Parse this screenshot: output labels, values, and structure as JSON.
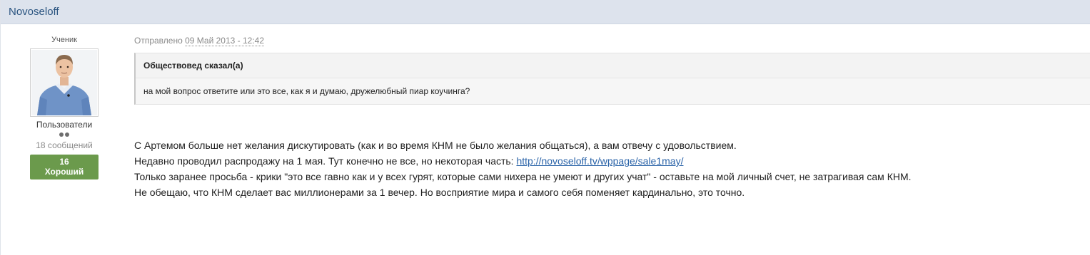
{
  "author": {
    "name": "Novoseloff",
    "rank": "Ученик",
    "group": "Пользователи",
    "post_count": "18 сообщений",
    "reputation": {
      "value": "16",
      "label": "Хороший",
      "color": "#6b9a4c"
    },
    "avatar_icon": "user-photo-avatar",
    "pips": 2
  },
  "post": {
    "date_prefix": "Отправлено",
    "date": "09 Май 2013 - 12:42",
    "quote": {
      "author_line": "Обществовед сказал(а)",
      "text": "на мой вопрос ответите или это все, как я и думаю, дружелюбный пиар коучинга?"
    },
    "lines": {
      "line1": "С Артемом больше нет желания дискутировать (как и во время КНМ не было желания общаться), а вам отвечу с удовольствием.",
      "line2_prefix": "Недавно проводил распродажу на 1 мая. Тут конечно не все, но некоторая часть: ",
      "line2_link": "http://novoseloff.tv/wppage/sale1may/",
      "line3": "Только заранее просьба - крики \"это все гавно как и у всех гурят, которые сами нихера не умеют и других учат\" - оставьте на мой личный счет, не затрагивая сам КНМ.",
      "line4": "Не обещаю, что КНМ сделает вас миллионерами за 1 вечер. Но восприятие мира и самого себя поменяет кардинально, это точно."
    }
  },
  "colors": {
    "header_bg": "#dde3ed",
    "author_link": "#2a5480",
    "body_link": "#2a63a8",
    "quote_bg": "#f6f6f6"
  }
}
